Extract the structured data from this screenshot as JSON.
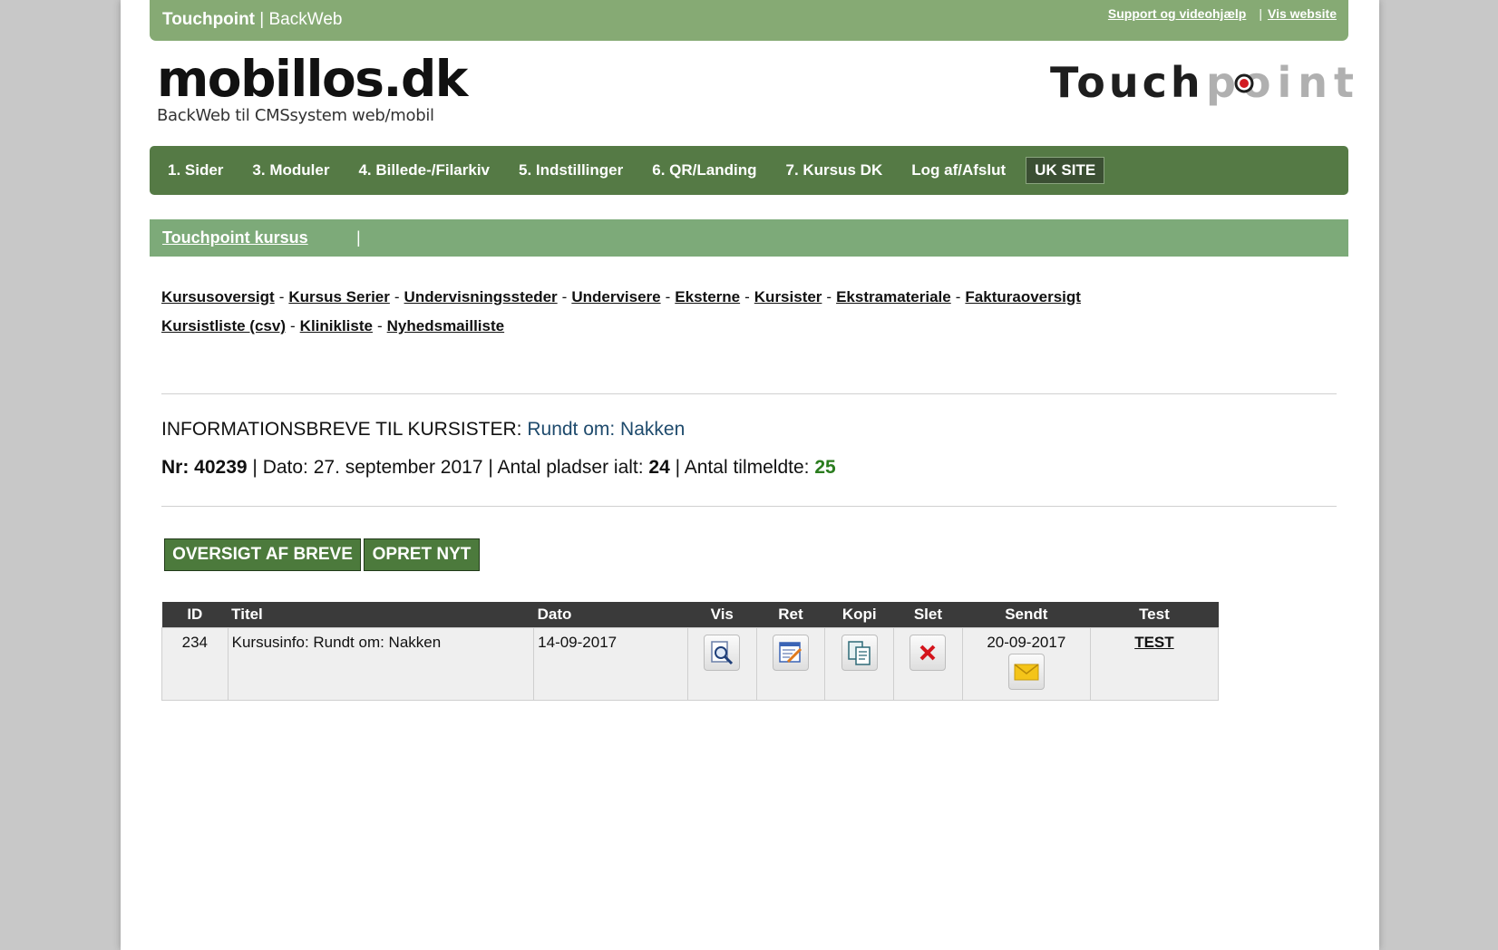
{
  "topbar": {
    "brand_bold": "Touchpoint",
    "brand_rest": " | BackWeb",
    "support_link": "Support og videohjælp",
    "separator": "|",
    "website_link": "Vis website"
  },
  "logo_left": {
    "title": "mobillos.dk",
    "subtitle": "BackWeb til CMSsystem web/mobil"
  },
  "logo_right": {
    "part1": "Touch",
    "part2": "point"
  },
  "mainnav": {
    "items": [
      "1. Sider",
      "3. Moduler",
      "4. Billede-/Filarkiv",
      "5. Indstillinger",
      "6. QR/Landing",
      "7. Kursus DK",
      "Log af/Afslut"
    ],
    "uk_site": "UK SITE"
  },
  "subbar": {
    "link": "Touchpoint kursus",
    "pipe": "|"
  },
  "submenu": {
    "line1": [
      "Kursusoversigt",
      "Kursus Serier",
      "Undervisningssteder",
      "Undervisere",
      "Eksterne",
      "Kursister",
      "Ekstramateriale",
      "Fakturaoversigt"
    ],
    "line2": [
      "Kursistliste (csv)",
      "Klinikliste",
      "Nyhedsmailliste"
    ],
    "dash": "-"
  },
  "heading": {
    "label": "INFORMATIONSBREVE TIL KURSISTER: ",
    "course_name": "Rundt om: Nakken"
  },
  "info": {
    "nr_label": "Nr: ",
    "nr_value": "40239",
    "date_text": " | Dato: 27. september 2017 | Antal pladser ialt: ",
    "seats_value": "24",
    "registered_label": " | Antal tilmeldte: ",
    "registered_value": "25"
  },
  "buttons": {
    "overview": "OVERSIGT AF BREVE",
    "create": "OPRET NYT"
  },
  "table": {
    "headers": {
      "id": "ID",
      "title": "Titel",
      "date": "Dato",
      "view": "Vis",
      "edit": "Ret",
      "copy": "Kopi",
      "delete": "Slet",
      "sent": "Sendt",
      "test": "Test"
    },
    "rows": [
      {
        "id": "234",
        "title": "Kursusinfo: Rundt om: Nakken",
        "date": "14-09-2017",
        "sent": "20-09-2017",
        "test": "TEST"
      }
    ]
  },
  "icons": {
    "view": "magnifier-document-icon",
    "edit": "edit-document-icon",
    "copy": "copy-documents-icon",
    "delete": "delete-x-icon",
    "send": "envelope-icon"
  },
  "colors": {
    "topbar": "#86aa74",
    "mainnav": "#557a45",
    "subbar": "#7daa79",
    "button": "#4c7a3c",
    "table_header": "#3a3a3a",
    "accent_green_number": "#2a7c1e",
    "course_name_blue": "#1e4a6c"
  }
}
